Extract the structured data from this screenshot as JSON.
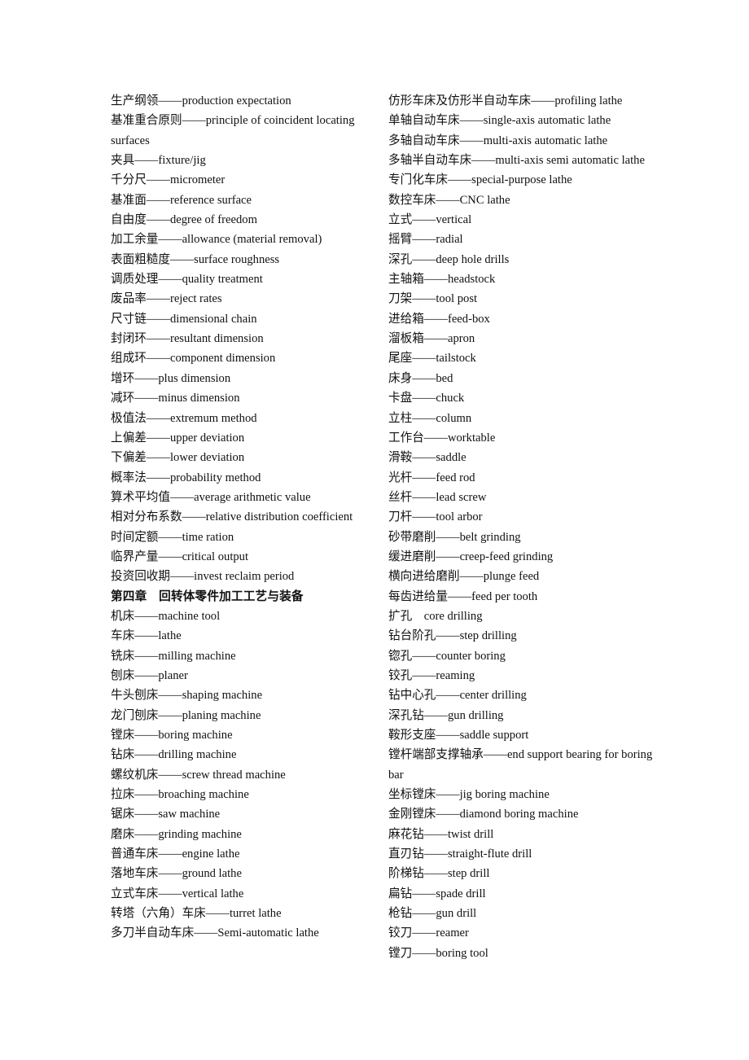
{
  "document": {
    "page_background": "#ffffff",
    "text_color": "#111111",
    "columns": {
      "left": {
        "entries": [
          {
            "text": "生产纲领——production expectation",
            "style": "normal"
          },
          {
            "text": "基准重合原则——principle of coincident locating surfaces",
            "style": "normal"
          },
          {
            "text": "夹具——fixture/jig",
            "style": "normal"
          },
          {
            "text": "千分尺——micrometer",
            "style": "normal"
          },
          {
            "text": "基准面——reference surface",
            "style": "normal"
          },
          {
            "text": "自由度——degree of freedom",
            "style": "normal"
          },
          {
            "text": "加工余量——allowance (material removal)",
            "style": "normal"
          },
          {
            "text": "表面粗糙度——surface roughness",
            "style": "normal"
          },
          {
            "text": "调质处理——quality treatment",
            "style": "normal"
          },
          {
            "text": "废品率——reject rates",
            "style": "normal"
          },
          {
            "text": "尺寸链——dimensional chain",
            "style": "normal"
          },
          {
            "text": "封闭环——resultant dimension",
            "style": "normal"
          },
          {
            "text": "组成环——component dimension",
            "style": "normal"
          },
          {
            "text": "增环——plus dimension",
            "style": "normal"
          },
          {
            "text": "减环——minus dimension",
            "style": "normal"
          },
          {
            "text": "极值法——extremum method",
            "style": "normal"
          },
          {
            "text": "上偏差——upper deviation",
            "style": "normal"
          },
          {
            "text": "下偏差——lower deviation",
            "style": "normal"
          },
          {
            "text": "概率法——probability method",
            "style": "normal"
          },
          {
            "text": "算术平均值——average arithmetic value",
            "style": "normal"
          },
          {
            "text": "相对分布系数——relative distribution coefficient",
            "style": "normal"
          },
          {
            "text": "时间定额——time ration",
            "style": "normal"
          },
          {
            "text": "临界产量——critical output",
            "style": "normal"
          },
          {
            "text": "投资回收期——invest reclaim period",
            "style": "normal"
          },
          {
            "text": "",
            "style": "spacer"
          },
          {
            "text": "第四章　回转体零件加工工艺与装备",
            "style": "heading"
          },
          {
            "text": "机床——machine tool",
            "style": "normal"
          },
          {
            "text": "车床——lathe",
            "style": "normal"
          },
          {
            "text": "铣床——milling machine",
            "style": "normal"
          },
          {
            "text": "刨床——planer",
            "style": "normal"
          },
          {
            "text": "牛头刨床——shaping machine",
            "style": "normal"
          },
          {
            "text": "龙门刨床——planing machine",
            "style": "normal"
          },
          {
            "text": "镗床——boring machine",
            "style": "normal"
          },
          {
            "text": "钻床——drilling machine",
            "style": "normal"
          },
          {
            "text": "螺纹机床——screw thread machine",
            "style": "normal"
          },
          {
            "text": "拉床——broaching machine",
            "style": "normal"
          },
          {
            "text": "锯床——saw machine",
            "style": "normal"
          },
          {
            "text": "磨床——grinding machine",
            "style": "normal"
          },
          {
            "text": "普通车床——engine lathe",
            "style": "normal"
          },
          {
            "text": "落地车床——ground lathe",
            "style": "normal"
          },
          {
            "text": "立式车床——vertical lathe",
            "style": "normal"
          },
          {
            "text": "转塔（六角）车床——turret lathe",
            "style": "normal"
          },
          {
            "text": "多刀半自动车床——Semi-automatic lathe",
            "style": "normal"
          }
        ]
      },
      "right": {
        "entries": [
          {
            "text": "仿形车床及仿形半自动车床——profiling lathe",
            "style": "normal"
          },
          {
            "text": "单轴自动车床——single-axis automatic lathe",
            "style": "normal"
          },
          {
            "text": "多轴自动车床——multi-axis automatic lathe",
            "style": "normal"
          },
          {
            "text": "多轴半自动车床——multi-axis semi automatic lathe",
            "style": "normal"
          },
          {
            "text": "专门化车床——special-purpose lathe",
            "style": "normal"
          },
          {
            "text": "数控车床——CNC lathe",
            "style": "normal"
          },
          {
            "text": "立式——vertical",
            "style": "normal"
          },
          {
            "text": "摇臂——radial",
            "style": "normal"
          },
          {
            "text": "深孔——deep hole drills",
            "style": "normal"
          },
          {
            "text": "主轴箱——headstock",
            "style": "normal"
          },
          {
            "text": "刀架——tool post",
            "style": "normal"
          },
          {
            "text": "进给箱——feed-box",
            "style": "normal"
          },
          {
            "text": "溜板箱——apron",
            "style": "normal"
          },
          {
            "text": "尾座——tailstock",
            "style": "normal"
          },
          {
            "text": "床身——bed",
            "style": "normal"
          },
          {
            "text": "卡盘——chuck",
            "style": "normal"
          },
          {
            "text": "立柱——column",
            "style": "normal"
          },
          {
            "text": "工作台——worktable",
            "style": "normal"
          },
          {
            "text": "滑鞍——saddle",
            "style": "normal"
          },
          {
            "text": "光杆——feed rod",
            "style": "normal"
          },
          {
            "text": "丝杆——lead screw",
            "style": "normal"
          },
          {
            "text": "刀杆——tool arbor",
            "style": "normal"
          },
          {
            "text": "砂带磨削——belt grinding",
            "style": "normal"
          },
          {
            "text": "缓进磨削——creep-feed grinding",
            "style": "normal"
          },
          {
            "text": "横向进给磨削——plunge feed",
            "style": "normal"
          },
          {
            "text": "每齿进给量——feed per tooth",
            "style": "normal"
          },
          {
            "text": "扩孔　core drilling",
            "style": "normal"
          },
          {
            "text": "钻台阶孔——step drilling",
            "style": "normal"
          },
          {
            "text": "锪孔——counter boring",
            "style": "normal"
          },
          {
            "text": "铰孔——reaming",
            "style": "normal"
          },
          {
            "text": "钻中心孔——center drilling",
            "style": "normal"
          },
          {
            "text": "深孔钻——gun drilling",
            "style": "normal"
          },
          {
            "text": "鞍形支座——saddle support",
            "style": "normal"
          },
          {
            "text": "镗杆端部支撑轴承——end support bearing for boring bar",
            "style": "normal"
          },
          {
            "text": "坐标镗床——jig boring machine",
            "style": "normal"
          },
          {
            "text": "金刚镗床——diamond boring machine",
            "style": "normal"
          },
          {
            "text": "麻花钻——twist drill",
            "style": "normal"
          },
          {
            "text": "直刃钻——straight-flute drill",
            "style": "normal"
          },
          {
            "text": "阶梯钻——step drill",
            "style": "normal"
          },
          {
            "text": "扁钻——spade drill",
            "style": "normal"
          },
          {
            "text": "枪钻——gun drill",
            "style": "normal"
          },
          {
            "text": "铰刀——reamer",
            "style": "normal"
          },
          {
            "text": "镗刀——boring tool",
            "style": "normal"
          }
        ]
      }
    }
  }
}
